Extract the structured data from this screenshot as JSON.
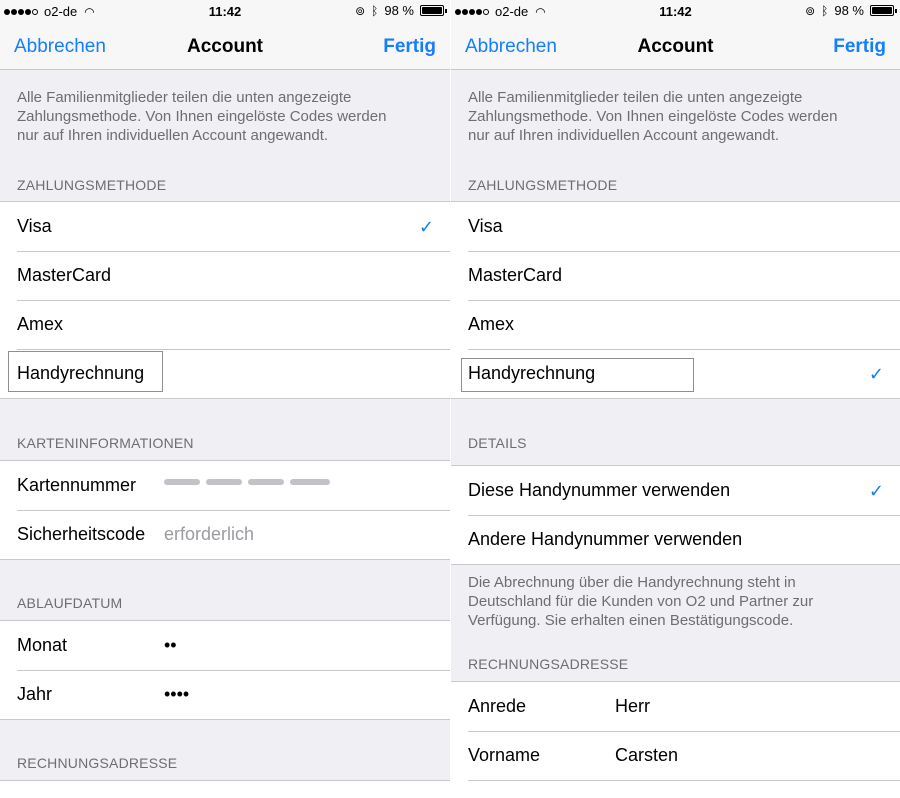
{
  "status_bar": {
    "carrier": "o2-de",
    "time": "11:42",
    "battery": "98 %"
  },
  "nav": {
    "cancel": "Abbrechen",
    "title": "Account",
    "done": "Fertig"
  },
  "left": {
    "info": "Alle Familienmitglieder teilen die unten angezeigte Zahlungsmethode. Von Ihnen eingelöste Codes werden nur auf Ihren individuellen Account angewandt.",
    "payment_header": "ZAHLUNGSMETHODE",
    "payment_methods": [
      "Visa",
      "MasterCard",
      "Amex",
      "Handyrechnung"
    ],
    "selected": "Visa",
    "card_header": "KARTENINFORMATIONEN",
    "card_number_label": "Kartennummer",
    "security_code_label": "Sicherheitscode",
    "security_code_placeholder": "erforderlich",
    "expiry_header": "ABLAUFDATUM",
    "month_label": "Monat",
    "month_value": "••",
    "year_label": "Jahr",
    "year_value": "••••",
    "billing_header": "RECHNUNGSADRESSE"
  },
  "right": {
    "info": "Alle Familienmitglieder teilen die unten angezeigte Zahlungsmethode. Von Ihnen eingelöste Codes werden nur auf Ihren individuellen Account angewandt.",
    "payment_header": "ZAHLUNGSMETHODE",
    "payment_methods": [
      "Visa",
      "MasterCard",
      "Amex",
      "Handyrechnung"
    ],
    "selected": "Handyrechnung",
    "details_header": "DETAILS",
    "detail_options": [
      "Diese Handynummer verwenden",
      "Andere Handynummer verwenden"
    ],
    "detail_selected": "Diese Handynummer verwenden",
    "details_note": "Die Abrechnung über die Handyrechnung steht in Deutschland für die Kunden von O2 und Partner zur Verfügung. Sie erhalten einen Bestätigungscode.",
    "billing_header": "RECHNUNGSADRESSE",
    "salutation_label": "Anrede",
    "salutation_value": "Herr",
    "firstname_label": "Vorname",
    "firstname_value": "Carsten"
  },
  "icons": {
    "checkmark": "checkmark-icon",
    "wifi": "wifi-icon",
    "bluetooth": "bluetooth-icon",
    "rotation_lock": "rotation-lock-icon",
    "battery": "battery-icon"
  },
  "colors": {
    "accent": "#147efb",
    "group_background": "#efeff4",
    "secondary_text": "#6d6d72"
  }
}
